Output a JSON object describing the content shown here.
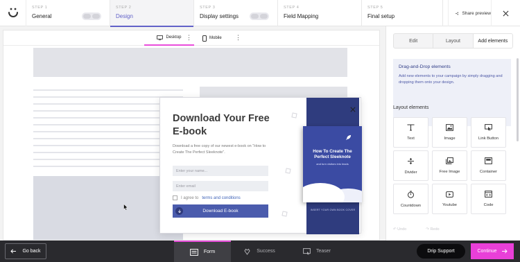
{
  "stepper": {
    "steps": [
      {
        "num": "STEP 1",
        "label": "General"
      },
      {
        "num": "STEP 2",
        "label": "Design"
      },
      {
        "num": "STEP 3",
        "label": "Display settings"
      },
      {
        "num": "STEP 4",
        "label": "Field Mapping"
      },
      {
        "num": "STEP 5",
        "label": "Final setup"
      }
    ],
    "share_label": "Share preview"
  },
  "canvas": {
    "device_tabs": [
      "Desktop",
      "Mobile"
    ],
    "popup": {
      "heading": "Download Your Free E-book",
      "description": "Download a free copy of our newest e-book on “How to Create The Perfect Sleeknote”.",
      "name_placeholder": "Enter your name...",
      "email_placeholder": "Enter email",
      "agree_prefix": "I agree to",
      "agree_link": "terms and conditions",
      "cta_label": "Download E-book",
      "book_title": "How To Create The Perfect Sleeknote",
      "book_subtitle": "and turn visitors into leads",
      "cover_caption": "INSERT YOUR OWN BOOK COVER"
    }
  },
  "panel": {
    "tabs": [
      "Edit",
      "Layout",
      "Add elements"
    ],
    "info_title": "Drag-and-Drop elements",
    "info_text": "Add new elements to your campaign by simply dragging and dropping them onto your design.",
    "section_title": "Layout elements",
    "elements": [
      {
        "name": "Text",
        "icon": "text-icon"
      },
      {
        "name": "Image",
        "icon": "image-icon"
      },
      {
        "name": "Link Button",
        "icon": "link-button-icon"
      },
      {
        "name": "Divider",
        "icon": "divider-icon"
      },
      {
        "name": "Free Image",
        "icon": "free-image-icon"
      },
      {
        "name": "Container",
        "icon": "container-icon"
      },
      {
        "name": "Countdown",
        "icon": "countdown-icon"
      },
      {
        "name": "Youtube",
        "icon": "youtube-icon"
      },
      {
        "name": "Code",
        "icon": "code-icon"
      }
    ],
    "undo": "Undo",
    "redo": "Redo"
  },
  "bottom": {
    "back_label": "Go back",
    "tabs": [
      "Form",
      "Success",
      "Teaser"
    ],
    "support_label": "Drip Support",
    "continue_label": "Continue"
  },
  "colors": {
    "accent": "#e93fd8",
    "primary": "#4b5cad",
    "active_step": "#6161c8"
  }
}
